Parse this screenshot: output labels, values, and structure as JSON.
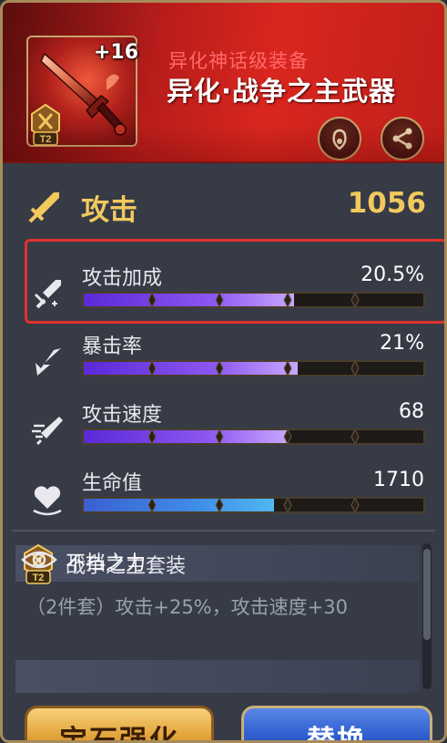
{
  "header": {
    "enhance_level": "+16",
    "tier": "T2",
    "sub_title": "异化神话级装备",
    "title": "异化·战争之主武器",
    "lock_icon": "lock-swirl-icon",
    "share_icon": "share-icon",
    "colors": {
      "header_red": "#d9261f",
      "sub_title": "#ff6a6a"
    }
  },
  "attack": {
    "label": "攻击",
    "value": "1056",
    "icon": "sword-icon",
    "color": "#f3c95e"
  },
  "stats": [
    {
      "label": "攻击加成",
      "value": "20.5%",
      "fill_fraction": 0.62,
      "color": "purple",
      "icon": "broken-sword-icon",
      "highlighted": true
    },
    {
      "label": "暴击率",
      "value": "21%",
      "fill_fraction": 0.63,
      "color": "purple",
      "icon": "crit-arrow-icon",
      "highlighted": false
    },
    {
      "label": "攻击速度",
      "value": "68",
      "fill_fraction": 0.6,
      "color": "purple",
      "icon": "speed-sword-icon",
      "highlighted": false
    },
    {
      "label": "生命值",
      "value": "1710",
      "fill_fraction": 0.56,
      "color": "blue",
      "icon": "heart-icon",
      "highlighted": false
    }
  ],
  "set": {
    "title": "战争之主套装",
    "tier": "T2",
    "description": "（2件套）攻击+25%，攻击速度+30",
    "skill_title": "不挡之力"
  },
  "buttons": {
    "gem": "宝石强化",
    "replace": "替换"
  }
}
